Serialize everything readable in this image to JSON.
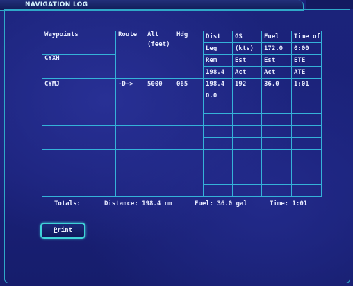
{
  "window": {
    "title": "NAVIGATION LOG"
  },
  "headers": {
    "waypoints": "Waypoints",
    "route": "Route",
    "alt": "Alt",
    "alt_unit": "(feet)",
    "hdg": "Hdg",
    "dist": "Dist",
    "leg": "Leg",
    "rem": "Rem",
    "gs": "GS",
    "kts": "(kts)",
    "est1": "Est",
    "act1": "Act",
    "fuel": "Fuel",
    "fuel_val": "172.0",
    "est2": "Est",
    "act2": "Act",
    "time_off": "Time off",
    "time_val": "0:00",
    "ete": "ETE",
    "ate": "ATE"
  },
  "origin": {
    "waypoint": "CYXH",
    "rem": "198.4"
  },
  "rows": [
    {
      "waypoint": "CYMJ",
      "route": "-D->",
      "alt": "5000",
      "hdg": "065",
      "leg": "198.4",
      "rem": "0.0",
      "gs": "192",
      "fuel": "36.0",
      "ete": "1:01"
    }
  ],
  "totals": {
    "label": "Totals:",
    "distance": "Distance:  198.4 nm",
    "fuel": "Fuel:  36.0 gal",
    "time": "Time:  1:01"
  },
  "print_button": {
    "label_underlined": "P",
    "label_rest": "rint"
  }
}
